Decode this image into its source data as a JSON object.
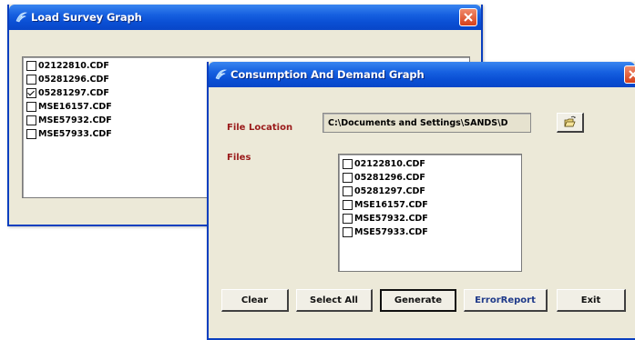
{
  "load_survey": {
    "title": "Load Survey Graph",
    "files": [
      {
        "name": "02122810.CDF",
        "checked": false
      },
      {
        "name": "05281296.CDF",
        "checked": false
      },
      {
        "name": "05281297.CDF",
        "checked": true
      },
      {
        "name": "MSE16157.CDF",
        "checked": false
      },
      {
        "name": "MSE57932.CDF",
        "checked": false
      },
      {
        "name": "MSE57933.CDF",
        "checked": false
      }
    ]
  },
  "consumption": {
    "title": "Consumption And Demand Graph",
    "file_location_label": "File Location",
    "file_location_value": "C:\\Documents and Settings\\SANDS\\D",
    "files_label": "Files",
    "files": [
      {
        "name": "02122810.CDF",
        "checked": false
      },
      {
        "name": "05281296.CDF",
        "checked": false
      },
      {
        "name": "05281297.CDF",
        "checked": false
      },
      {
        "name": "MSE16157.CDF",
        "checked": false
      },
      {
        "name": "MSE57932.CDF",
        "checked": false
      },
      {
        "name": "MSE57933.CDF",
        "checked": false
      }
    ],
    "buttons": {
      "clear": "Clear",
      "select_all": "Select All",
      "generate": "Generate",
      "error_report": "ErrorReport",
      "exit": "Exit"
    }
  },
  "colors": {
    "titlebar": "#0a4fd4",
    "window_bg": "#ece9d8",
    "label_red": "#9a1a1a",
    "error_report_blue": "#1f3a8a"
  },
  "icons": {
    "app": "app-icon",
    "close": "close-icon",
    "browse": "folder-browse-icon",
    "checkbox": "checkbox-icon"
  }
}
